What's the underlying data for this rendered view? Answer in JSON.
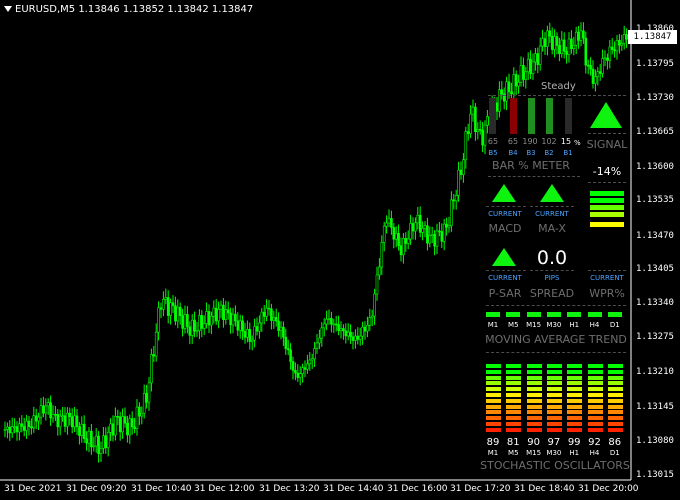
{
  "chart_header": {
    "symbol": "EURUSD,M5",
    "ohlc": "1.13846 1.13852 1.13842 1.13847"
  },
  "current_price": "1.13847",
  "price_axis": [
    "1.13860",
    "1.13795",
    "1.13730",
    "1.13665",
    "1.13600",
    "1.13535",
    "1.13470",
    "1.13405",
    "1.13340",
    "1.13275",
    "1.13210",
    "1.13145",
    "1.13080",
    "1.13015"
  ],
  "time_axis": [
    "31 Dec 2021",
    "31 Dec 09:20",
    "31 Dec 10:40",
    "31 Dec 12:00",
    "31 Dec 13:20",
    "31 Dec 14:40",
    "31 Dec 16:00",
    "31 Dec 17:20",
    "31 Dec 18:40",
    "31 Dec 20:00"
  ],
  "colors": {
    "background": "#000000",
    "candles": "#00ff00",
    "green": "#0ff40f",
    "dark_green": "#1f8f1f",
    "red": "#8b0000",
    "gray_text": "#6e6e6e",
    "blue_label": "#4aa3ff",
    "yellow": "#ffff00"
  },
  "panel": {
    "steady_label": "Steady",
    "bar_meter": {
      "values": [
        "65",
        "65",
        "190",
        "102",
        "15"
      ],
      "value_unit": "%",
      "labels": [
        "B5",
        "B4",
        "B3",
        "B2",
        "B1"
      ],
      "bar_colors": [
        "#2a2a2a",
        "#8b0000",
        "#1f8f1f",
        "#1f8f1f",
        "#2a2a2a"
      ],
      "title": "BAR % METER"
    },
    "signal": {
      "title": "SIGNAL",
      "icon": "up-arrow-icon"
    },
    "percent": "-14%",
    "level_bars": 5,
    "macd": {
      "status": "CURRENT",
      "title": "MACD",
      "icon": "up-arrow-icon"
    },
    "ma_x": {
      "status": "CURRENT",
      "title": "MA-X",
      "icon": "up-arrow-icon"
    },
    "p_sar": {
      "status": "CURRENT",
      "title": "P-SAR",
      "icon": "up-arrow-icon"
    },
    "spread": {
      "value": "0.0",
      "unit": "PIPS",
      "title": "SPREAD"
    },
    "wpr": {
      "status": "CURRENT",
      "title": "WPR%"
    },
    "ma_trend": {
      "timeframes": [
        "M1",
        "M5",
        "M15",
        "M30",
        "H1",
        "H4",
        "D1"
      ],
      "title": "MOVING AVERAGE TREND"
    },
    "stochastic": {
      "values": [
        "89",
        "81",
        "90",
        "97",
        "99",
        "92",
        "86"
      ],
      "timeframes": [
        "M1",
        "M5",
        "M15",
        "M30",
        "H1",
        "H4",
        "D1"
      ],
      "title": "STOCHASTIC OSCILLATORS"
    }
  }
}
